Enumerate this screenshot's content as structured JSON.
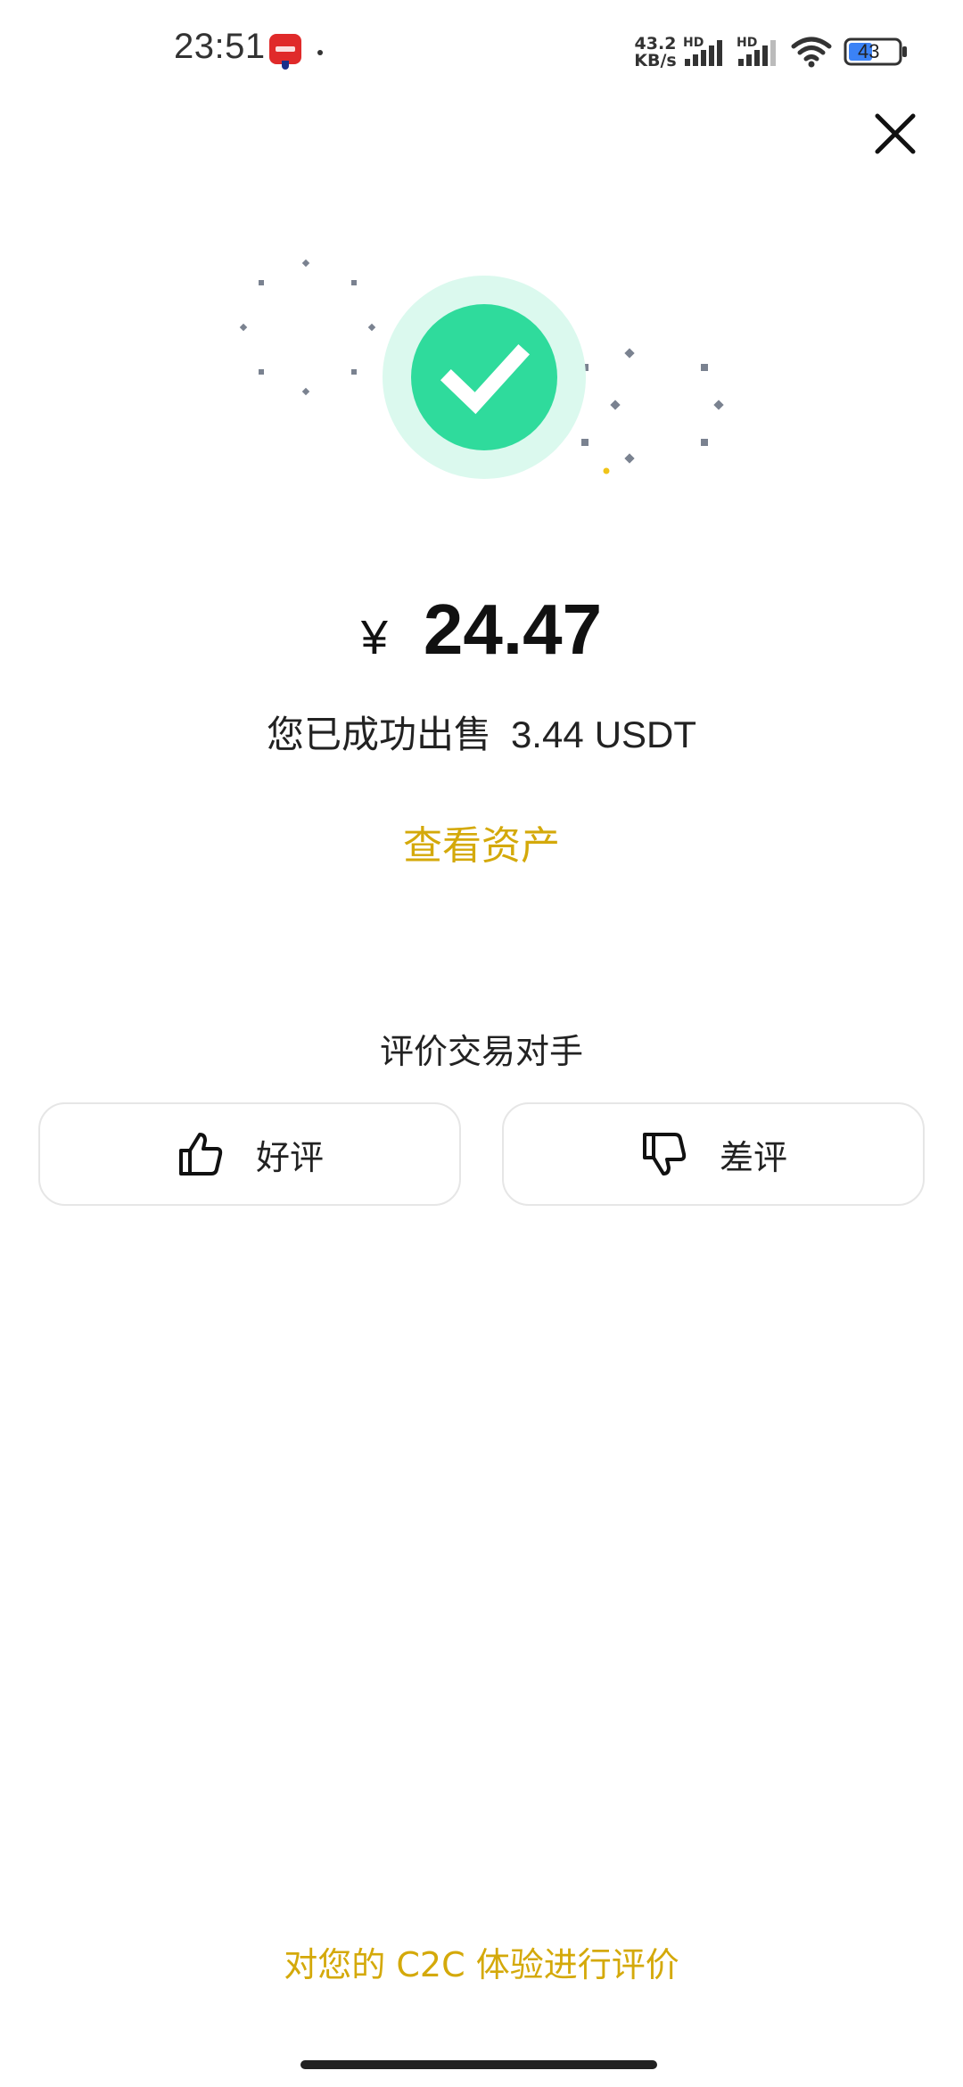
{
  "status_bar": {
    "time": "23:51",
    "app_icon": "payment-app-icon",
    "net_speed_value": "43.2",
    "net_speed_unit": "KB/s",
    "signal_1_label": "HD",
    "signal_2_label": "HD",
    "battery_level": "43"
  },
  "header": {
    "close_icon": "close-icon"
  },
  "success": {
    "icon": "check-circle-icon",
    "accent_color": "#2fdb9c",
    "accent_light": "#dbf9ee"
  },
  "result": {
    "currency_symbol": "¥",
    "amount": "24.47",
    "sold_label": "您已成功出售",
    "sold_amount": "3.44",
    "sold_unit": "USDT",
    "view_assets_label": "查看资产"
  },
  "rating": {
    "title": "评价交易对手",
    "good_label": "好评",
    "good_icon": "thumbs-up-icon",
    "bad_label": "差评",
    "bad_icon": "thumbs-down-icon"
  },
  "footer": {
    "feedback_link": "对您的 C2C 体验进行评价",
    "link_color": "#d4a90a"
  }
}
